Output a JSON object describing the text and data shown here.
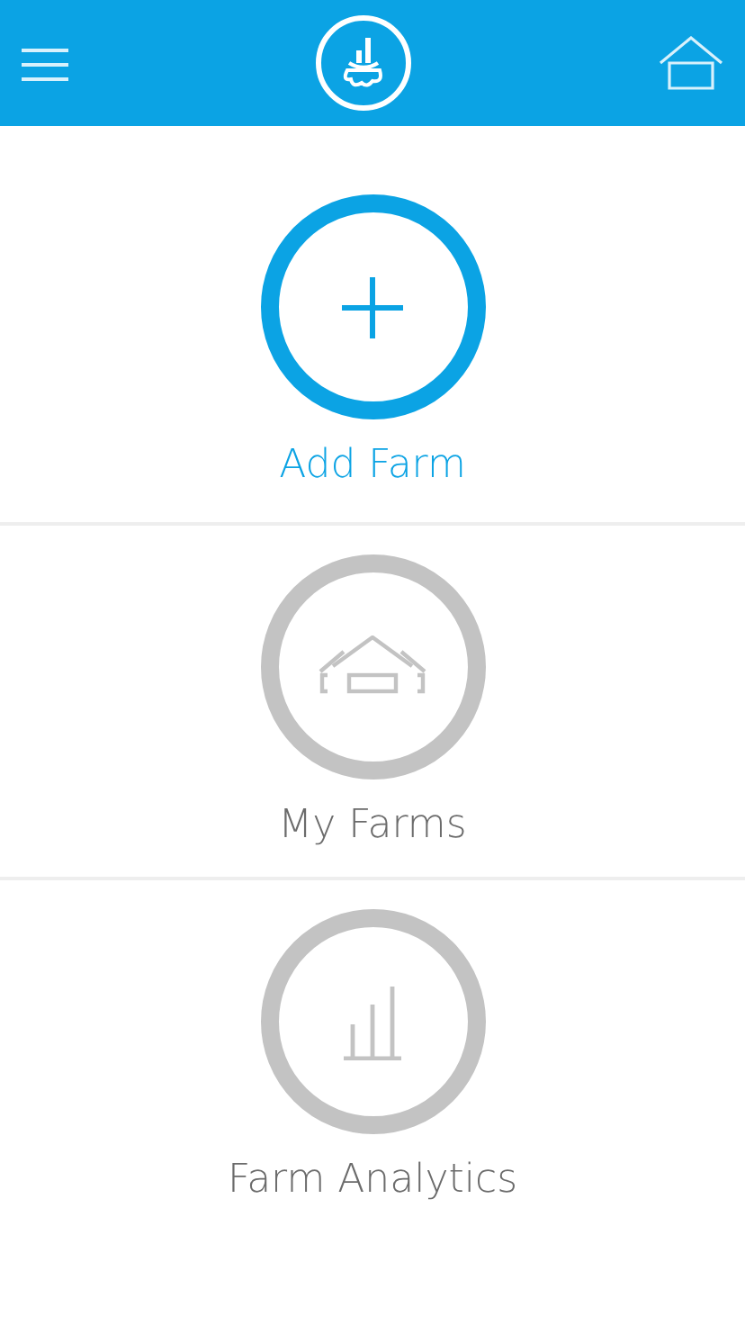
{
  "items": [
    {
      "kind": "add",
      "label": "Add Farm",
      "selected": true
    },
    {
      "kind": "farms",
      "label": "My Farms",
      "selected": false
    },
    {
      "kind": "analytics",
      "label": "Farm Analytics",
      "selected": false
    }
  ]
}
